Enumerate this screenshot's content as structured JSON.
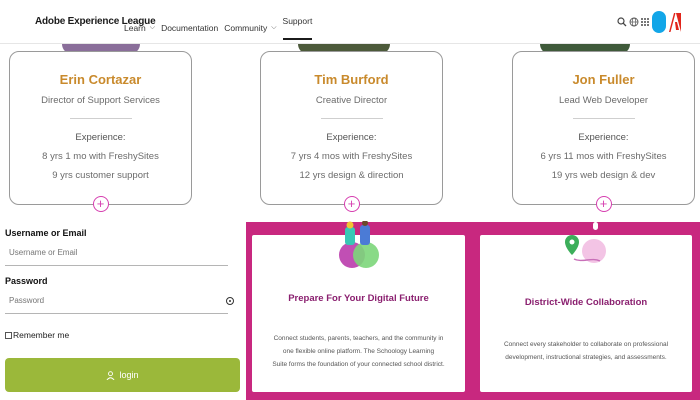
{
  "nav": {
    "brand": "Adobe Experience League",
    "links": [
      {
        "label": "Learn",
        "caret": "⌵"
      },
      {
        "label": "Documentation",
        "caret": ""
      },
      {
        "label": "Community",
        "caret": "⌵"
      },
      {
        "label": "Support",
        "caret": ""
      }
    ]
  },
  "team": [
    {
      "name": "Erin Cortazar",
      "role": "Director of Support Services",
      "experience_heading": "Experience:",
      "exp1": "8 yrs 1 mo with FreshySites",
      "exp2": "9 yrs customer support"
    },
    {
      "name": "Tim Burford",
      "role": "Creative Director",
      "experience_heading": "Experience:",
      "exp1": "7 yrs 4 mos with FreshySites",
      "exp2": "12 yrs design & direction"
    },
    {
      "name": "Jon Fuller",
      "role": "Lead Web Developer",
      "experience_heading": "Experience:",
      "exp1": "6 yrs 11 mos with FreshySites",
      "exp2": "19 yrs web design & dev"
    }
  ],
  "login": {
    "username_label": "Username or Email",
    "username_placeholder": "Username or Email",
    "password_label": "Password",
    "password_placeholder": "Password",
    "remember_label": "Remember me",
    "button_label": "login"
  },
  "features": [
    {
      "title": "Prepare For Your Digital Future",
      "desc_lines": [
        "Connect students, parents, teachers, and the community in",
        "one flexible online platform. The Schoology Learning",
        "Suite forms the foundation of your connected school district."
      ]
    },
    {
      "title": "District-Wide Collaboration",
      "desc_lines": [
        "Connect every stakeholder to collaborate on professional",
        "development, instructional strategies, and assessments."
      ]
    }
  ],
  "colors": {
    "accent_gold": "#c98a2c",
    "magenta": "#c8287f",
    "login_green": "#9bb83a",
    "feature_title": "#8a1f6f"
  }
}
